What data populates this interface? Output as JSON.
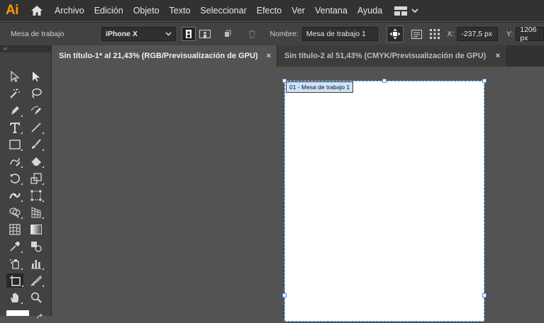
{
  "app": {
    "logo": "Ai",
    "brand_color": "#ff9a00"
  },
  "menu": [
    "Archivo",
    "Edición",
    "Objeto",
    "Texto",
    "Seleccionar",
    "Efecto",
    "Ver",
    "Ventana",
    "Ayuda"
  ],
  "control_bar": {
    "selection_label": "Mesa de trabajo",
    "preset": "iPhone X",
    "name_label": "Nombre:",
    "name_value": "Mesa de trabajo 1",
    "x_label": "X:",
    "x_value": "-237,5 px",
    "y_label": "Y:",
    "y_value": "1206 px"
  },
  "toolbar": {
    "collapse": "‹‹"
  },
  "tabs": [
    {
      "label": "Sin título-1* al 21,43% (RGB/Previsualización de GPU)",
      "close": "×",
      "active": true
    },
    {
      "label": "Sin título-2 al 51,43% (CMYK/Previsualización de GPU)",
      "close": "×",
      "active": false
    }
  ],
  "artboard": {
    "label": "01 - Mesa de trabajo 1",
    "fill": "#ffffff",
    "selection_color": "#4aa3ff"
  }
}
